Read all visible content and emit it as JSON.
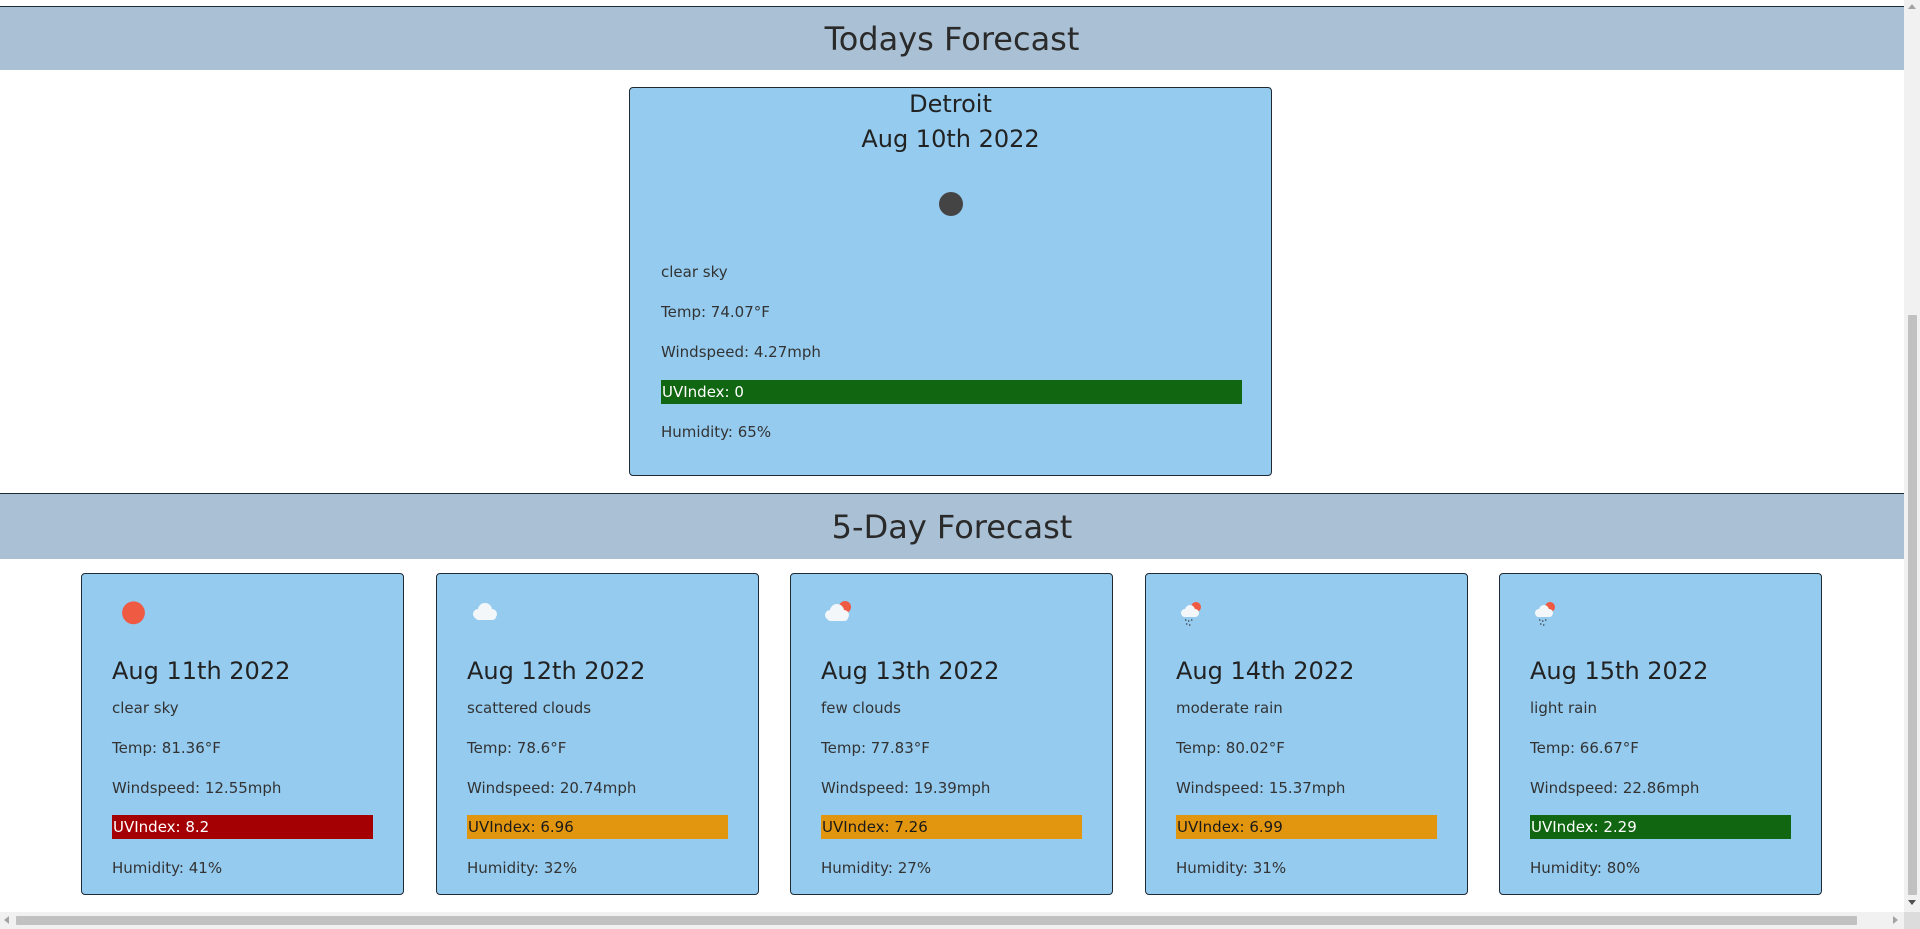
{
  "today": {
    "heading": "Todays Forecast",
    "city": "Detroit",
    "date": "Aug 10th 2022",
    "icon": "clear-night-moon-icon",
    "description": "clear sky",
    "temp": "Temp: 74.07°F",
    "windspeed": "Windspeed: 4.27mph",
    "uv": {
      "text": "UVIndex: 0",
      "level": "low",
      "color": "#116611"
    },
    "humidity": "Humidity: 65%"
  },
  "five_day": {
    "heading": "5-Day Forecast",
    "days": [
      {
        "date": "Aug 11th 2022",
        "icon": "sun-icon",
        "description": "clear sky",
        "temp": "Temp: 81.36°F",
        "windspeed": "Windspeed: 12.55mph",
        "uv": {
          "text": "UVIndex: 8.2",
          "level": "very-high",
          "color": "#a40004"
        },
        "humidity": "Humidity: 41%"
      },
      {
        "date": "Aug 12th 2022",
        "icon": "cloud-icon",
        "description": "scattered clouds",
        "temp": "Temp: 78.6°F",
        "windspeed": "Windspeed: 20.74mph",
        "uv": {
          "text": "UVIndex: 6.96",
          "level": "moderate",
          "color": "#e2960f"
        },
        "humidity": "Humidity: 32%"
      },
      {
        "date": "Aug 13th 2022",
        "icon": "partly-cloudy-icon",
        "description": "few clouds",
        "temp": "Temp: 77.83°F",
        "windspeed": "Windspeed: 19.39mph",
        "uv": {
          "text": "UVIndex: 7.26",
          "level": "moderate",
          "color": "#e2960f"
        },
        "humidity": "Humidity: 27%"
      },
      {
        "date": "Aug 14th 2022",
        "icon": "rain-cloud-sun-icon",
        "description": "moderate rain",
        "temp": "Temp: 80.02°F",
        "windspeed": "Windspeed: 15.37mph",
        "uv": {
          "text": "UVIndex: 6.99",
          "level": "moderate",
          "color": "#e2960f"
        },
        "humidity": "Humidity: 31%"
      },
      {
        "date": "Aug 15th 2022",
        "icon": "rain-cloud-sun-icon",
        "description": "light rain",
        "temp": "Temp: 66.67°F",
        "windspeed": "Windspeed: 22.86mph",
        "uv": {
          "text": "UVIndex: 2.29",
          "level": "low",
          "color": "#116611"
        },
        "humidity": "Humidity: 80%"
      }
    ]
  },
  "colors": {
    "banner": "#aac1d5",
    "card": "#94cbef",
    "uv_low": "#116611",
    "uv_moderate": "#e2960f",
    "uv_very_high": "#a40004"
  }
}
